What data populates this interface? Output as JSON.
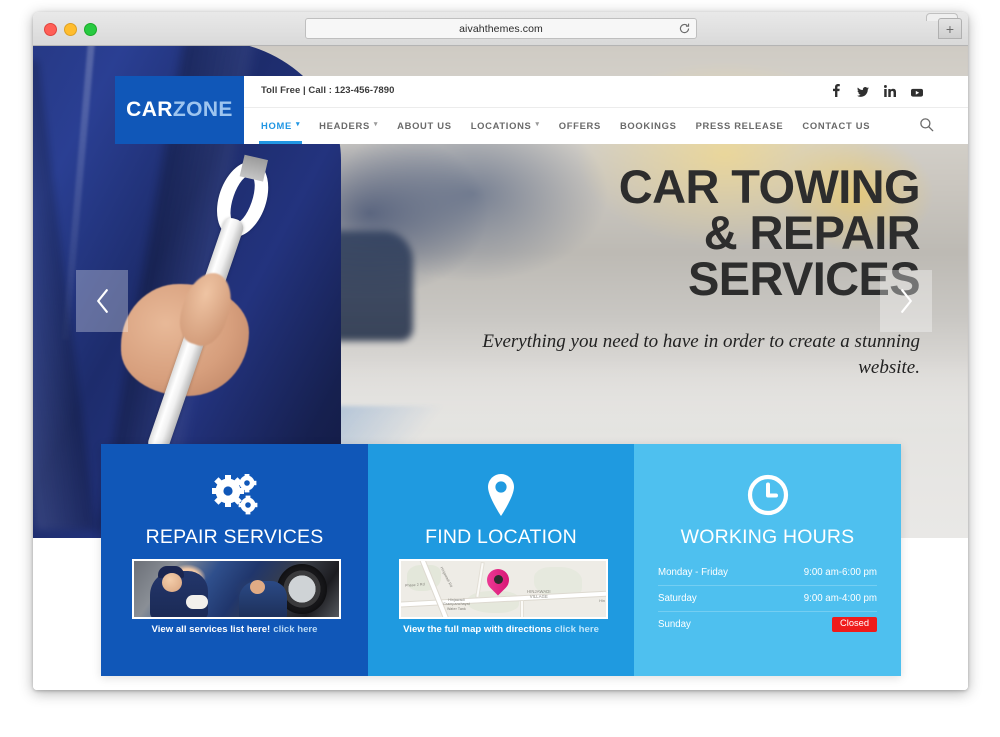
{
  "browser": {
    "url": "aivahthemes.com",
    "reload_icon": "reload-icon",
    "newtab_label": "+",
    "traffic_lights": [
      "close",
      "minimize",
      "zoom"
    ]
  },
  "header": {
    "logo": {
      "part1": "CAR",
      "part2": "ZONE"
    },
    "topbar": {
      "phone_label": "Toll Free | Call : 123-456-7890"
    },
    "socials": [
      {
        "name": "facebook-icon",
        "label": "f"
      },
      {
        "name": "twitter-icon",
        "label": "t"
      },
      {
        "name": "linkedin-icon",
        "label": "in"
      },
      {
        "name": "youtube-icon",
        "label": "yt"
      }
    ],
    "nav": [
      {
        "label": "HOME",
        "has_dropdown": true,
        "active": true
      },
      {
        "label": "HEADERS",
        "has_dropdown": true,
        "active": false
      },
      {
        "label": "ABOUT US",
        "has_dropdown": false,
        "active": false
      },
      {
        "label": "LOCATIONS",
        "has_dropdown": true,
        "active": false
      },
      {
        "label": "OFFERS",
        "has_dropdown": false,
        "active": false
      },
      {
        "label": "BOOKINGS",
        "has_dropdown": false,
        "active": false
      },
      {
        "label": "PRESS RELEASE",
        "has_dropdown": false,
        "active": false
      },
      {
        "label": "CONTACT US",
        "has_dropdown": false,
        "active": false
      }
    ],
    "search_icon": "search-icon"
  },
  "hero": {
    "title_line1": "CAR TOWING",
    "title_line2": "& REPAIR",
    "title_line3": "SERVICES",
    "subtitle": "Everything you need to have in order to create a stunning website.",
    "prev_label": "‹",
    "next_label": "›"
  },
  "cards": [
    {
      "id": "repair-services",
      "icon": "gears-icon",
      "title": "REPAIR SERVICES",
      "cta_text": "View all services list here!",
      "cta_link": "click here",
      "bg": "#1057b8"
    },
    {
      "id": "find-location",
      "icon": "map-pin-icon",
      "title": "FIND LOCATION",
      "cta_text": "View the full map with directions",
      "cta_link": "click here",
      "bg": "#1f9ae0",
      "map": {
        "labels": {
          "road_phase": "Phase 2 Rd",
          "road_hinjawadi": "Hinjawadi Rd",
          "village": "HINJAWADI\nVILLAGE",
          "water_tank": "Hinjawadi\nGrampanchayat\nWater Tank",
          "edge": "Hin"
        }
      }
    },
    {
      "id": "working-hours",
      "icon": "clock-icon",
      "title": "WORKING HOURS",
      "bg": "#4ec0ef",
      "rows": [
        {
          "day": "Monday - Friday",
          "value": "9:00 am-6:00 pm",
          "closed": false
        },
        {
          "day": "Saturday",
          "value": "9:00 am-4:00 pm",
          "closed": false
        },
        {
          "day": "Sunday",
          "value": "Closed",
          "closed": true
        }
      ]
    }
  ],
  "colors": {
    "brand_dark_blue": "#1057b8",
    "brand_mid_blue": "#1f9ae0",
    "brand_light_blue": "#4ec0ef",
    "accent_cyan": "#2196e3",
    "closed_red": "#ef1b1b",
    "logo_zone": "#9dc4ef"
  }
}
